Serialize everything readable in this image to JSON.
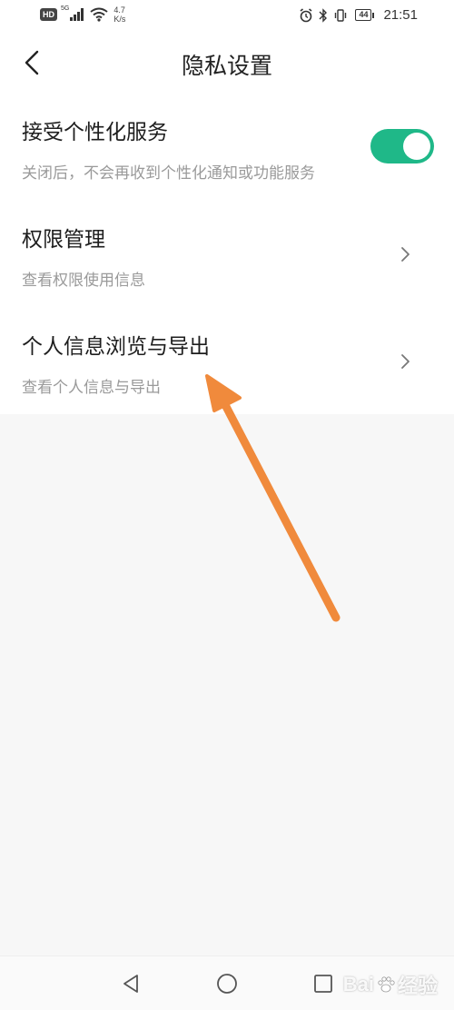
{
  "status_bar": {
    "hd_label": "HD",
    "network_label": "5G",
    "speed_value": "4.7",
    "speed_unit": "K/s",
    "battery_level": "44",
    "time": "21:51",
    "icons": [
      "hd-icon",
      "signal-icon",
      "wifi-icon",
      "alarm-icon",
      "bluetooth-icon",
      "vibrate-icon",
      "battery-icon"
    ]
  },
  "header": {
    "title": "隐私设置",
    "back_icon": "back-arrow-icon"
  },
  "settings": {
    "items": [
      {
        "title": "接受个性化服务",
        "subtitle": "关闭后，不会再收到个性化通知或功能服务",
        "control": "toggle",
        "toggle_on": true
      },
      {
        "title": "权限管理",
        "subtitle": "查看权限使用信息",
        "control": "chevron"
      },
      {
        "title": "个人信息浏览与导出",
        "subtitle": "查看个人信息与导出",
        "control": "chevron"
      }
    ]
  },
  "annotation": {
    "arrow_color": "#f08a3c"
  },
  "colors": {
    "toggle_on": "#1fb888",
    "background": "#f7f7f7",
    "card": "#ffffff",
    "subtitle": "#9a9a9a"
  },
  "nav_bar": {
    "buttons": [
      "nav-back-icon",
      "nav-home-icon",
      "nav-recents-icon"
    ]
  },
  "watermark": {
    "text_left": "Bai",
    "text_right": "经验"
  }
}
